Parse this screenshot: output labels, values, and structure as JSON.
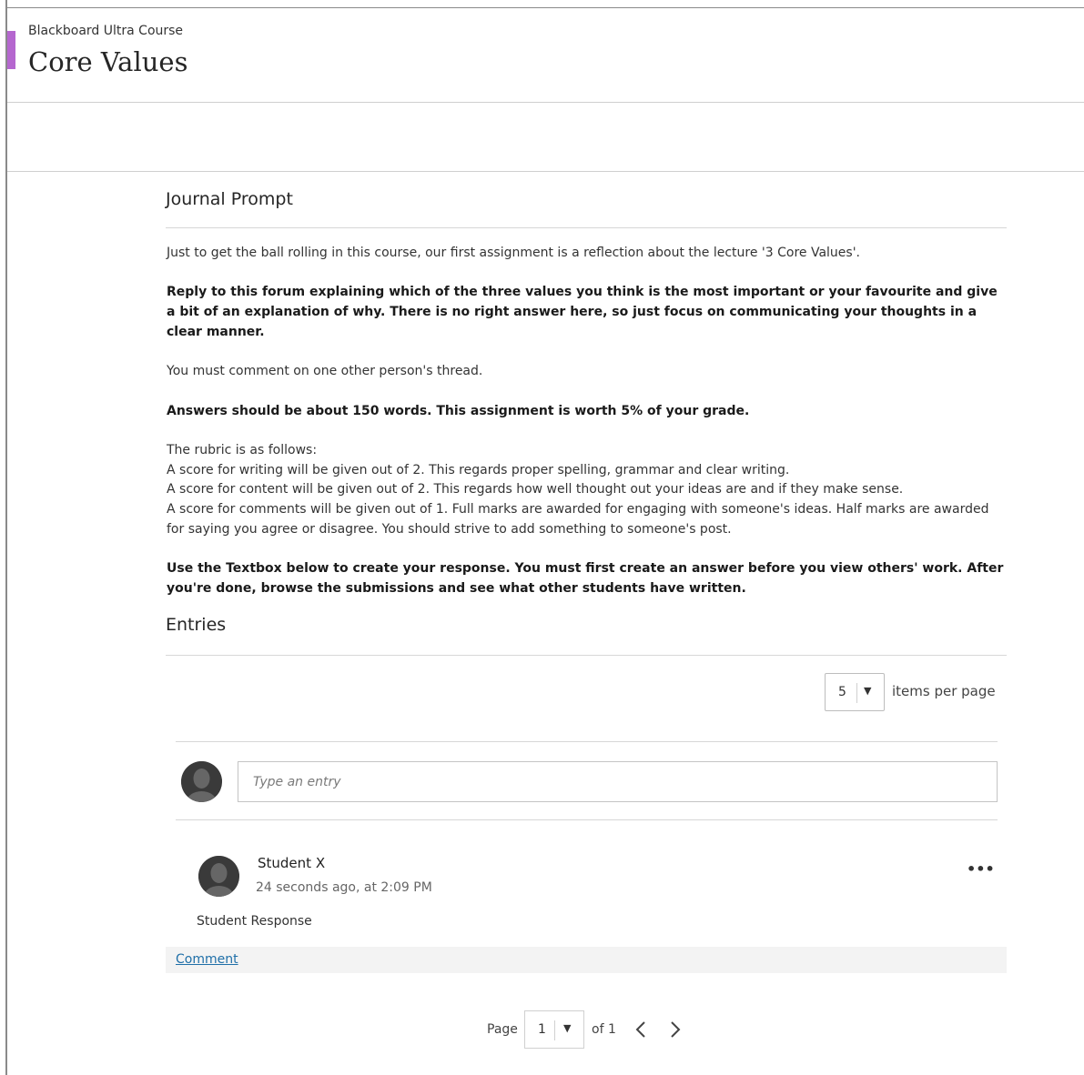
{
  "header": {
    "course_name": "Blackboard Ultra Course",
    "title": "Core Values"
  },
  "journal": {
    "section_title": "Journal Prompt",
    "intro": "Just to get the ball rolling in this course, our first assignment is a reflection about the lecture '3 Core Values'.",
    "instruction_bold": "Reply to this forum explaining which of the three values you think is the most important or your favourite and give a bit of an explanation of why. There is no right answer here, so just focus on communicating your thoughts in a clear manner.",
    "comment_requirement": "You must comment on one other person's thread.",
    "length_bold": "Answers should be about 150 words. This assignment is worth 5% of your grade.",
    "rubric_heading": "The rubric is as follows:",
    "rubric_writing": "A score for writing will be given out of 2. This regards proper spelling, grammar and clear writing.",
    "rubric_content": "A score for content will be given out of 2. This regards how well thought out your ideas are and if they make sense.",
    "rubric_comments": "A score for comments will be given out of 1. Full marks are awarded for engaging with someone's ideas. Half marks are awarded for saying you agree or disagree. You should strive to add something to someone's post.",
    "closing_bold": "Use the Textbox below to create your response. You must first create an answer before you view others' work. After you're done, browse the submissions and see what other students have written."
  },
  "entries": {
    "section_title": "Entries",
    "items_per_page_value": "5",
    "items_per_page_label": "items per page",
    "input_placeholder": "Type an entry",
    "list": [
      {
        "author": "Student X",
        "timestamp": "24 seconds ago, at 2:09 PM",
        "body": "Student Response",
        "comment_label": "Comment"
      }
    ]
  },
  "pagination": {
    "page_label": "Page",
    "current_page": "1",
    "of_label": "of 1"
  },
  "icons": {
    "dropdown": "▼",
    "more": "•••"
  },
  "colors": {
    "accent": "#b567cf",
    "link": "#1f6fa8"
  }
}
